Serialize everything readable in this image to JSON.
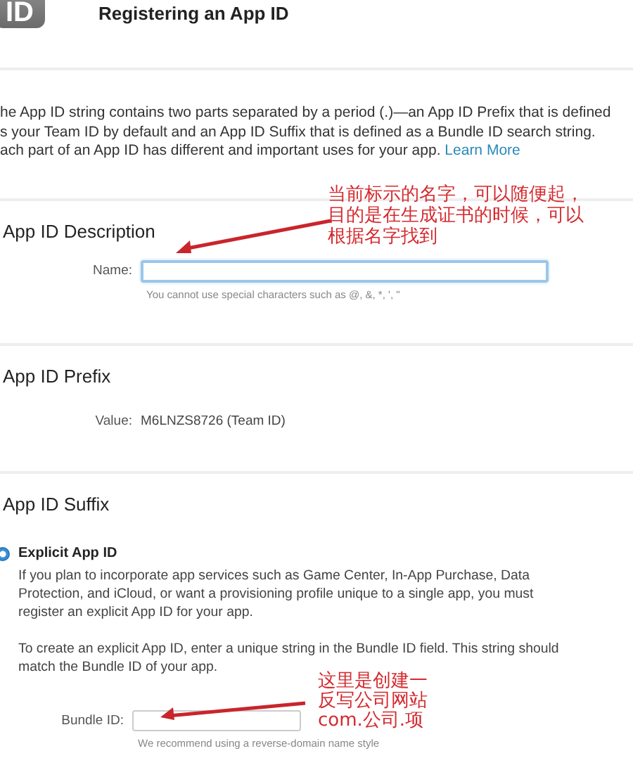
{
  "header": {
    "icon_text": "ID",
    "title": "Registering an App ID"
  },
  "intro": {
    "lines": [
      "he App ID string contains two parts separated by a period (.)—an App ID Prefix that is defined",
      "s your Team ID by default and an App ID Suffix that is defined as a Bundle ID search string.",
      "ach part of an App ID has different and important uses for your app."
    ],
    "link": "Learn More"
  },
  "sections": [
    {
      "kind": "field",
      "heading": "App ID Description",
      "label": "Name:",
      "hint": "You cannot use special characters such as @, &, *, ', \""
    },
    {
      "kind": "value",
      "heading": "App ID Prefix",
      "label": "Value:",
      "value": "M6LNZS8726 (Team ID)"
    },
    {
      "kind": "options",
      "heading": "App ID Suffix",
      "options": [
        {
          "label": "Explicit App ID",
          "selected": true,
          "paragraphs": [
            "If you plan to incorporate app services such as Game Center, In-App Purchase, Data Protection, and iCloud, or want a provisioning profile unique to a single app, you must register an explicit App ID for your app.",
            "To create an explicit App ID, enter a unique string in the Bundle ID field. This string should match the Bundle ID of your app."
          ],
          "field": {
            "label": "Bundle ID:",
            "hint": "We recommend using a reverse-domain name style"
          }
        }
      ]
    }
  ],
  "annotations": [
    {
      "lines": [
        "当前标示的名字，可以随便起，",
        "目的是在生成证书的时候，可以",
        "根据名字找到"
      ]
    },
    {
      "lines": [
        "这里是创建一",
        "反写公司网站",
        "com.公司.项"
      ]
    }
  ]
}
